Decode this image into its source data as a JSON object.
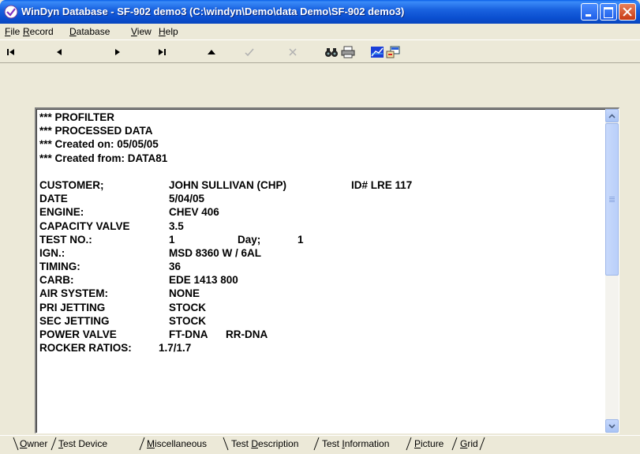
{
  "window": {
    "title": "WinDyn Database - SF-902 demo3  (C:\\windyn\\Demo\\data Demo\\SF-902 demo3)"
  },
  "menu": [
    {
      "key": "F",
      "rest": "ile"
    },
    {
      "key": "R",
      "rest": "ecord"
    },
    {
      "key": "D",
      "rest": "atabase"
    },
    {
      "key": "V",
      "rest": "iew"
    },
    {
      "key": "H",
      "rest": "elp"
    }
  ],
  "toolbar": {
    "icons": [
      "first-record-icon",
      "previous-record-icon",
      "next-record-icon",
      "last-record-icon",
      "up-icon",
      "check-icon",
      "cancel-icon",
      "find-icon",
      "print-icon",
      "chart-icon",
      "export-icon"
    ]
  },
  "record": {
    "header": [
      "*** PROFILTER",
      "*** PROCESSED DATA",
      "*** Created on: 05/05/05",
      "*** Created from: DATA81"
    ],
    "customer": {
      "label": "CUSTOMER;",
      "value": "JOHN SULLIVAN (CHP)",
      "extra": "ID# LRE 117"
    },
    "date": {
      "label": "DATE",
      "value": "5/04/05"
    },
    "engine": {
      "label": "ENGINE:",
      "value": "CHEV 406"
    },
    "capacity_valve": {
      "label": "CAPACITY VALVE",
      "value": "3.5"
    },
    "test_no": {
      "label": "TEST NO.:",
      "value": "1",
      "day_label": "Day;",
      "day_value": "1"
    },
    "ign": {
      "label": "IGN.:",
      "value": "MSD 8360 W /  6AL"
    },
    "timing": {
      "label": "TIMING:",
      "value": "36"
    },
    "carb": {
      "label": "CARB:",
      "value": "EDE 1413 800"
    },
    "air_system": {
      "label": "AIR SYSTEM:",
      "value": "NONE"
    },
    "pri_jetting": {
      "label": "PRI JETTING",
      "value": "STOCK"
    },
    "sec_jetting": {
      "label": "SEC JETTING",
      "value": "STOCK"
    },
    "power_valve": {
      "label": "POWER VALVE",
      "value": "FT-DNA",
      "value2": "RR-DNA"
    },
    "rocker_ratios": {
      "label": "ROCKER RATIOS:",
      "value": "1.7/1.7"
    }
  },
  "tabs": [
    {
      "key": "O",
      "rest": "wner"
    },
    {
      "key": "T",
      "rest": "est Device"
    },
    {
      "key": "M",
      "rest": "iscellaneous"
    },
    {
      "key": "",
      "rest": "Test ",
      "key2": "D",
      "rest2": "escription",
      "active": true
    },
    {
      "key": "",
      "rest": "Test ",
      "key2": "I",
      "rest2": "nformation"
    },
    {
      "key": "P",
      "rest": "icture"
    },
    {
      "key": "G",
      "rest": "rid"
    }
  ]
}
